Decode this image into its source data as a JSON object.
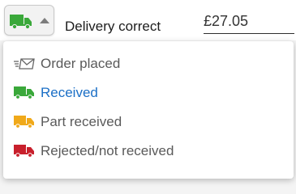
{
  "delivery": {
    "label": "Delivery correct",
    "amount": "£27.05",
    "selected_status_icon": "green-truck-icon"
  },
  "status_menu": {
    "options": [
      {
        "label": "Order placed",
        "icon": "mail-sent-icon"
      },
      {
        "label": "Received",
        "icon": "green-truck-icon",
        "color": "#3aa83a",
        "selected": true
      },
      {
        "label": "Part received",
        "icon": "amber-truck-icon",
        "color": "#f0a91a"
      },
      {
        "label": "Rejected/not received",
        "icon": "red-truck-icon",
        "color": "#c8202c"
      }
    ]
  },
  "colors": {
    "selected_text": "#1b6fc6",
    "truck_green": "#3aa83a",
    "truck_amber": "#f0a91a",
    "truck_red": "#c8202c"
  }
}
